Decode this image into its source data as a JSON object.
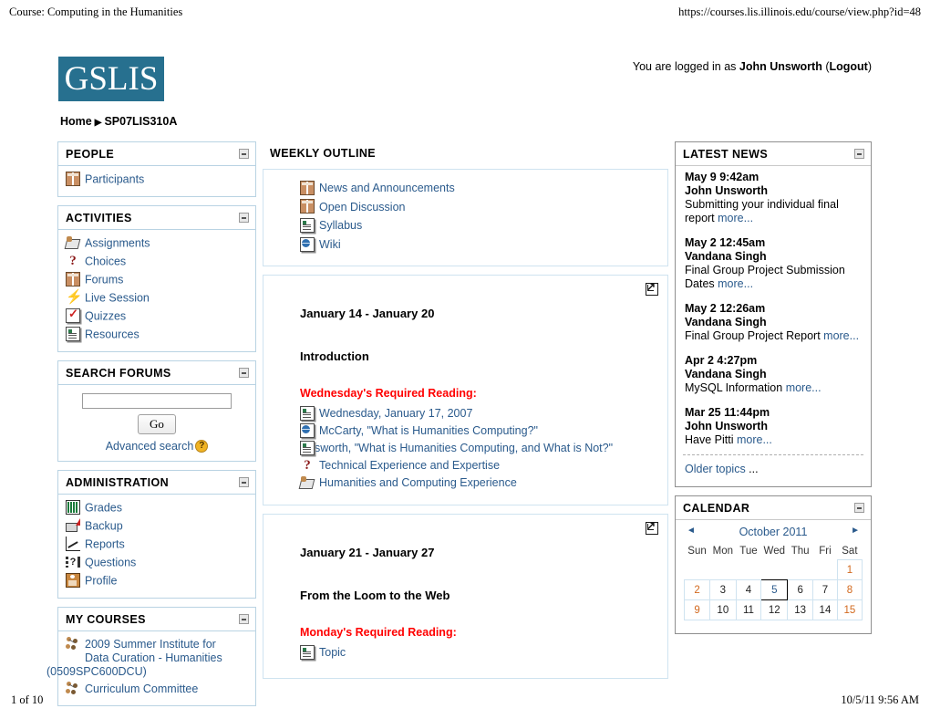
{
  "print": {
    "header_left": "Course: Computing in the Humanities",
    "header_right": "https://courses.lis.illinois.edu/course/view.php?id=48",
    "footer_left": "1 of 10",
    "footer_right": "10/5/11 9:56 AM"
  },
  "header": {
    "logo_text": "GSLIS",
    "logo_color": "#27708f",
    "login_prefix": "You are logged in as ",
    "login_user": "John Unsworth",
    "login_paren_open": " (",
    "logout_label": "Logout",
    "login_paren_close": ")",
    "breadcrumb_home": "Home",
    "breadcrumb_arrow": "▶",
    "breadcrumb_course": "SP07LIS310A"
  },
  "sidebar_left": {
    "people": {
      "title": "PEOPLE",
      "items": [
        {
          "label": "Participants",
          "icon": "forum-icon"
        }
      ]
    },
    "activities": {
      "title": "ACTIVITIES",
      "items": [
        {
          "label": "Assignments",
          "icon": "assignment-icon"
        },
        {
          "label": "Choices",
          "icon": "choice-icon"
        },
        {
          "label": "Forums",
          "icon": "forum-icon"
        },
        {
          "label": "Live Session",
          "icon": "live-session-icon"
        },
        {
          "label": "Quizzes",
          "icon": "quiz-icon"
        },
        {
          "label": "Resources",
          "icon": "document-icon"
        }
      ]
    },
    "search_forums": {
      "title": "SEARCH FORUMS",
      "input_value": "",
      "input_placeholder": "",
      "go_label": "Go",
      "advanced_label": "Advanced search",
      "help_icon": "help-icon"
    },
    "administration": {
      "title": "ADMINISTRATION",
      "items": [
        {
          "label": "Grades",
          "icon": "grades-icon"
        },
        {
          "label": "Backup",
          "icon": "backup-icon"
        },
        {
          "label": "Reports",
          "icon": "reports-icon"
        },
        {
          "label": "Questions",
          "icon": "questions-icon"
        },
        {
          "label": "Profile",
          "icon": "profile-icon"
        }
      ]
    },
    "my_courses": {
      "title": "MY COURSES",
      "items": [
        {
          "line1": "2009 Summer Institute for",
          "line2": "Data Curation - Humanities",
          "line3": "(0509SPC600DCU)",
          "icon": "course-icon"
        },
        {
          "line1": "Curriculum Committee",
          "line2": "",
          "line3": "",
          "icon": "course-icon"
        }
      ]
    }
  },
  "main": {
    "title": "WEEKLY OUTLINE",
    "section_zero": {
      "links": [
        {
          "label": "News and Announcements",
          "icon": "forum-icon"
        },
        {
          "label": "Open Discussion",
          "icon": "forum-icon"
        },
        {
          "label": "Syllabus",
          "icon": "document-icon"
        },
        {
          "label": "Wiki",
          "icon": "wiki-icon"
        }
      ]
    },
    "weeks": [
      {
        "date_range": "January 14 - January 20",
        "topic": "Introduction",
        "reading_heading": "Wednesday's Required Reading:",
        "highlight_icon": "highlight-week-icon",
        "links": [
          {
            "label": "Wednesday, January 17, 2007",
            "icon": "document-icon"
          },
          {
            "label": "McCarty, \"What is Humanities Computing?\"",
            "icon": "wiki-icon"
          },
          {
            "label": "Unsworth, \"What is Humanities Computing, and What is Not?\"",
            "icon": "document-icon"
          },
          {
            "label": "Technical Experience and Expertise",
            "icon": "choice-icon"
          },
          {
            "label": "Humanities and Computing Experience",
            "icon": "assignment-icon"
          }
        ]
      },
      {
        "date_range": "January 21 - January 27",
        "topic": "From the Loom to the Web",
        "reading_heading": "Monday's Required Reading:",
        "highlight_icon": "highlight-week-icon",
        "links": [
          {
            "label": "Topic",
            "icon": "document-icon"
          }
        ]
      }
    ]
  },
  "sidebar_right": {
    "latest_news": {
      "title": "LATEST NEWS",
      "items": [
        {
          "date": "May 9 9:42am",
          "author": "John Unsworth",
          "text": "Submitting your individual final report ",
          "more": "more..."
        },
        {
          "date": "May 2 12:45am",
          "author": "Vandana Singh",
          "text": "Final Group Project Submission Dates ",
          "more": "more..."
        },
        {
          "date": "May 2 12:26am",
          "author": "Vandana Singh",
          "text": "Final Group Project Report ",
          "more": "more..."
        },
        {
          "date": "Apr 2 4:27pm",
          "author": "Vandana Singh",
          "text": "MySQL Information ",
          "more": "more..."
        },
        {
          "date": "Mar 25 11:44pm",
          "author": "John Unsworth",
          "text": "Have Pitti ",
          "more": "more..."
        }
      ],
      "older_label": "Older topics",
      "older_dots": " ..."
    },
    "calendar": {
      "title": "CALENDAR",
      "prev_icon": "◄",
      "next_icon": "►",
      "month_label": "October 2011",
      "day_headers": [
        "Sun",
        "Mon",
        "Tue",
        "Wed",
        "Thu",
        "Fri",
        "Sat"
      ],
      "weeks": [
        [
          {
            "d": "",
            "t": "empty"
          },
          {
            "d": "",
            "t": "empty"
          },
          {
            "d": "",
            "t": "empty"
          },
          {
            "d": "",
            "t": "empty"
          },
          {
            "d": "",
            "t": "empty"
          },
          {
            "d": "",
            "t": "empty"
          },
          {
            "d": "1",
            "t": "weekend"
          }
        ],
        [
          {
            "d": "2",
            "t": "weekend"
          },
          {
            "d": "3",
            "t": "day"
          },
          {
            "d": "4",
            "t": "day"
          },
          {
            "d": "5",
            "t": "today"
          },
          {
            "d": "6",
            "t": "day"
          },
          {
            "d": "7",
            "t": "day"
          },
          {
            "d": "8",
            "t": "weekend"
          }
        ],
        [
          {
            "d": "9",
            "t": "weekend"
          },
          {
            "d": "10",
            "t": "day"
          },
          {
            "d": "11",
            "t": "day"
          },
          {
            "d": "12",
            "t": "day"
          },
          {
            "d": "13",
            "t": "day"
          },
          {
            "d": "14",
            "t": "day"
          },
          {
            "d": "15",
            "t": "weekend"
          }
        ]
      ]
    }
  }
}
